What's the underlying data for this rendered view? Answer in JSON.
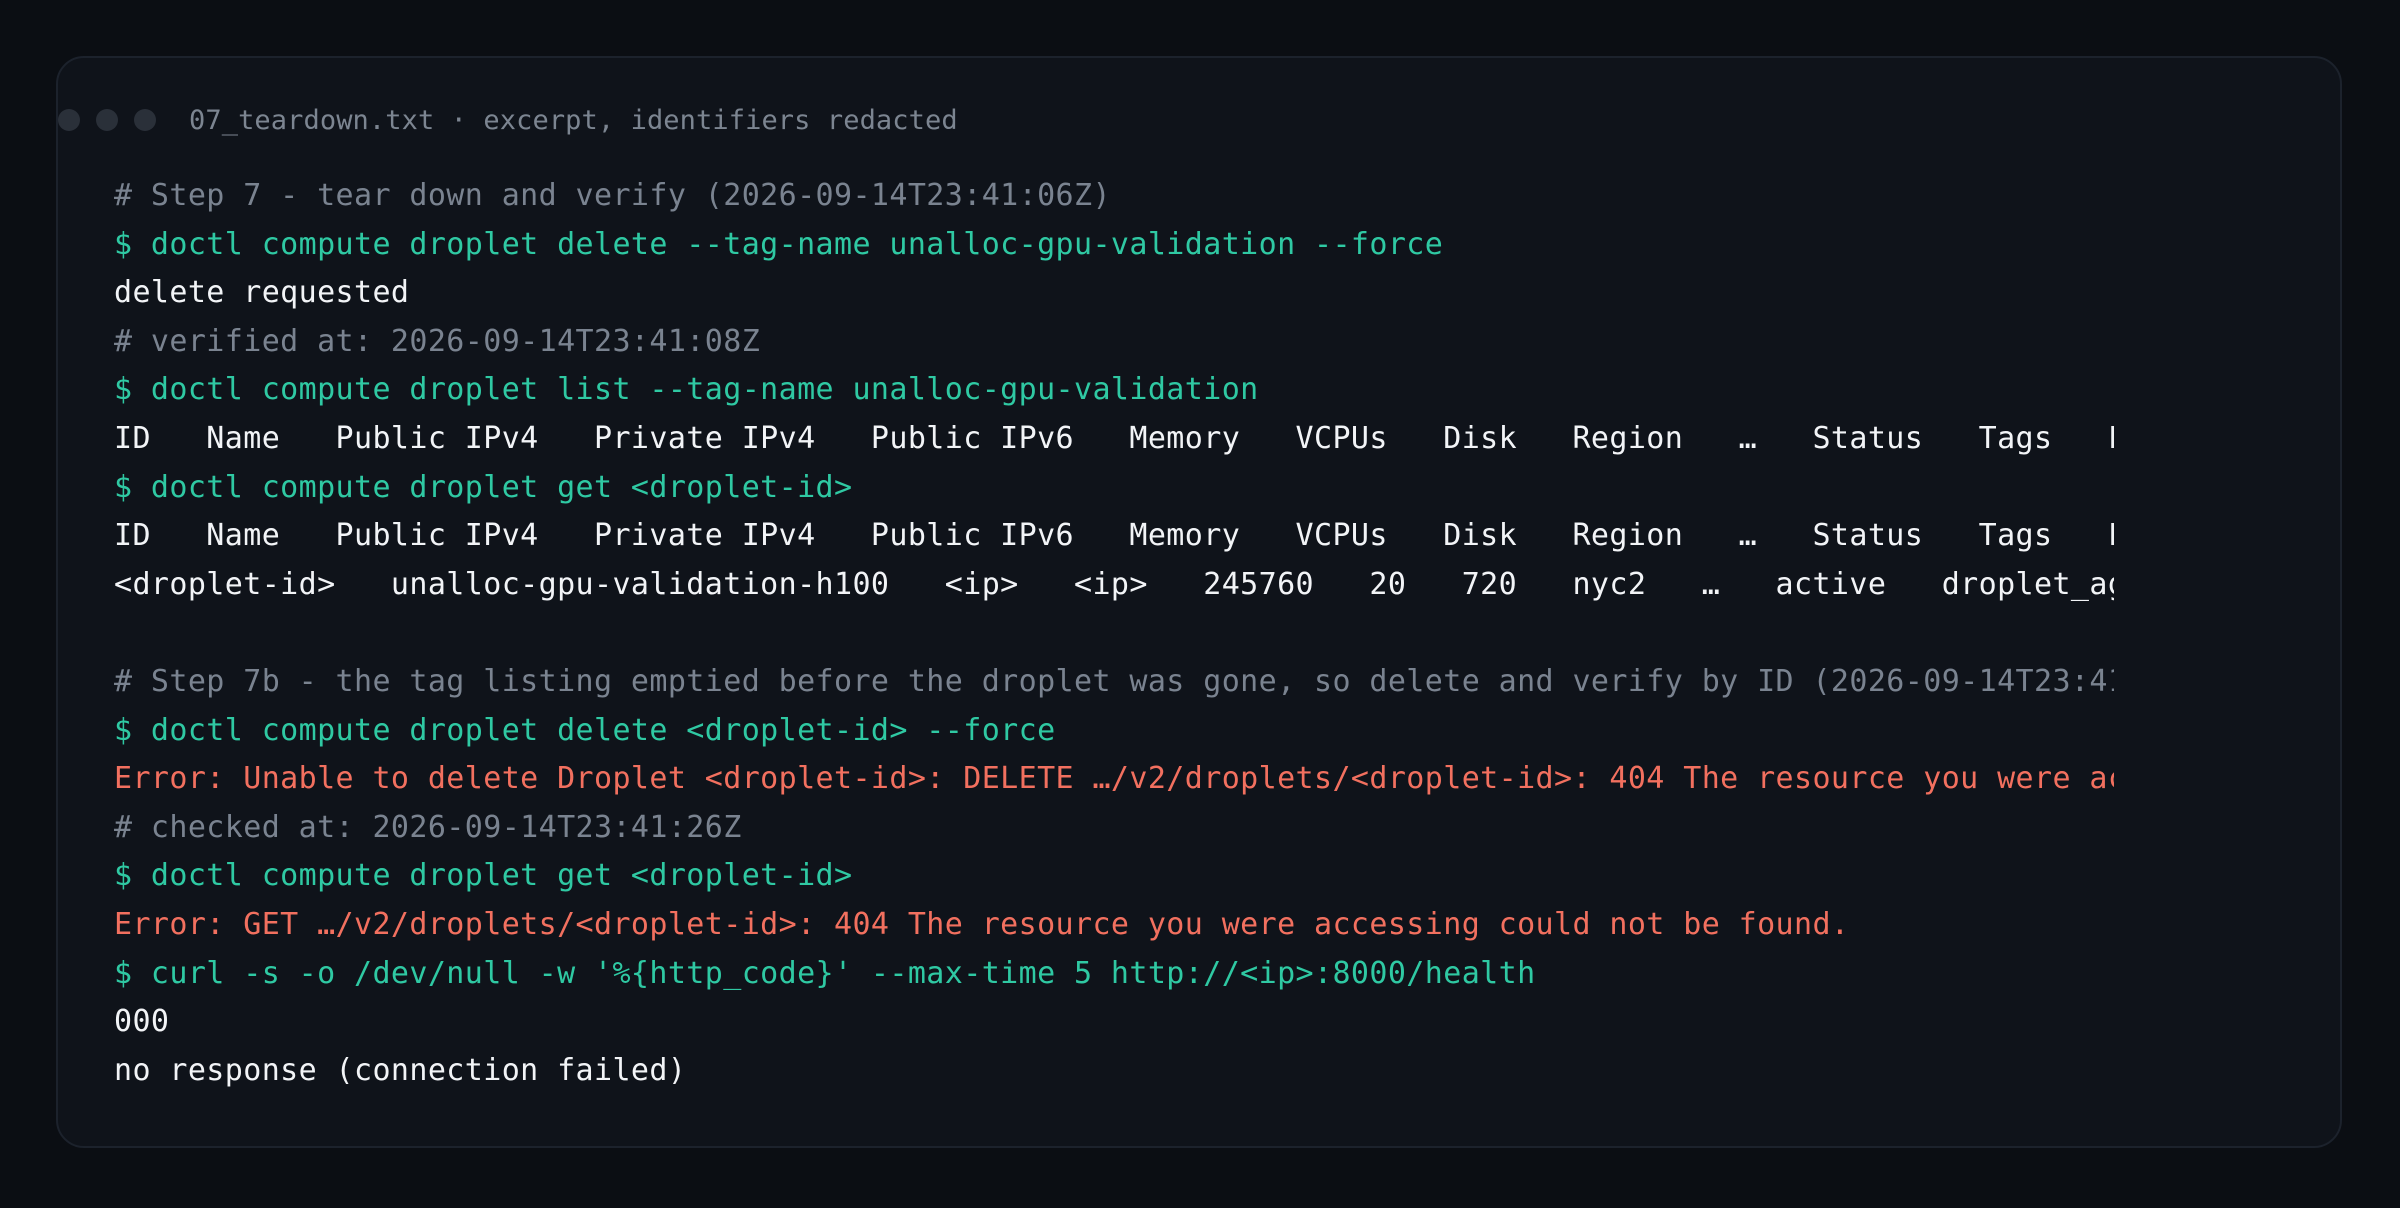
{
  "window": {
    "title": "07_teardown.txt · excerpt, identifiers redacted",
    "traffic_lights": [
      "close-dot",
      "minimize-dot",
      "maximize-dot"
    ]
  },
  "colors": {
    "background": "#0b0e13",
    "panel": "#0f131a",
    "comment": "#7a8390",
    "command": "#2fc9a3",
    "output": "#f2f4f7",
    "error": "#f2705f"
  },
  "lines": [
    {
      "kind": "comment",
      "text": "# Step 7 - tear down and verify (2026-09-14T23:41:06Z)"
    },
    {
      "kind": "cmd",
      "text": "$ doctl compute droplet delete --tag-name unalloc-gpu-validation --force"
    },
    {
      "kind": "out",
      "text": "delete requested"
    },
    {
      "kind": "comment",
      "text": "# verified at: 2026-09-14T23:41:08Z"
    },
    {
      "kind": "cmd",
      "text": "$ doctl compute droplet list --tag-name unalloc-gpu-validation"
    },
    {
      "kind": "out",
      "text": "ID   Name   Public IPv4   Private IPv4   Public IPv6   Memory   VCPUs   Disk   Region   …   Status   Tags   F…"
    },
    {
      "kind": "cmd",
      "text": "$ doctl compute droplet get <droplet-id>"
    },
    {
      "kind": "out",
      "text": "ID   Name   Public IPv4   Private IPv4   Public IPv6   Memory   VCPUs   Disk   Region   …   Status   Tags   F…"
    },
    {
      "kind": "out",
      "text": "<droplet-id>   unalloc-gpu-validation-h100   <ip>   <ip>   245760   20   720   nyc2   …   active   droplet_ag…"
    },
    {
      "kind": "blank",
      "text": " "
    },
    {
      "kind": "comment",
      "text": "# Step 7b - the tag listing emptied before the droplet was gone, so delete and verify by ID (2026-09-14T23:41…"
    },
    {
      "kind": "cmd",
      "text": "$ doctl compute droplet delete <droplet-id> --force"
    },
    {
      "kind": "err",
      "text": "Error: Unable to delete Droplet <droplet-id>: DELETE …/v2/droplets/<droplet-id>: 404 The resource you were ac…"
    },
    {
      "kind": "comment",
      "text": "# checked at: 2026-09-14T23:41:26Z"
    },
    {
      "kind": "cmd",
      "text": "$ doctl compute droplet get <droplet-id>"
    },
    {
      "kind": "err",
      "text": "Error: GET …/v2/droplets/<droplet-id>: 404 The resource you were accessing could not be found."
    },
    {
      "kind": "cmd",
      "text": "$ curl -s -o /dev/null -w '%{http_code}' --max-time 5 http://<ip>:8000/health"
    },
    {
      "kind": "out",
      "text": "000"
    },
    {
      "kind": "out",
      "text": "no response (connection failed)"
    }
  ]
}
